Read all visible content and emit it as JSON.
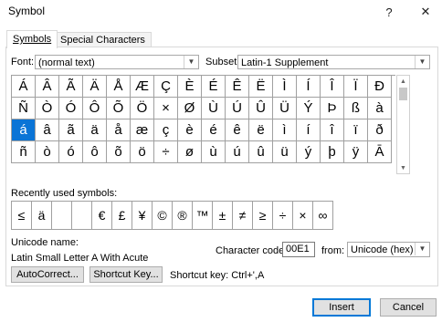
{
  "window": {
    "title": "Symbol",
    "help_glyph": "?",
    "close_glyph": "✕"
  },
  "tabs": [
    {
      "label": "Symbols"
    },
    {
      "label": "Special Characters"
    }
  ],
  "font": {
    "label": "Font:",
    "value": "(normal text)"
  },
  "subset": {
    "label": "Subset:",
    "value": "Latin-1 Supplement"
  },
  "grid": {
    "rows": [
      [
        "Á",
        "Â",
        "Ã",
        "Ä",
        "Å",
        "Æ",
        "Ç",
        "È",
        "É",
        "Ê",
        "Ë",
        "Ì",
        "Í",
        "Î",
        "Ï",
        "Ð"
      ],
      [
        "Ñ",
        "Ò",
        "Ó",
        "Ô",
        "Õ",
        "Ö",
        "×",
        "Ø",
        "Ù",
        "Ú",
        "Û",
        "Ü",
        "Ý",
        "Þ",
        "ß",
        "à"
      ],
      [
        "á",
        "â",
        "ã",
        "ä",
        "å",
        "æ",
        "ç",
        "è",
        "é",
        "ê",
        "ë",
        "ì",
        "í",
        "î",
        "ï",
        "ð"
      ],
      [
        "ñ",
        "ò",
        "ó",
        "ô",
        "õ",
        "ö",
        "÷",
        "ø",
        "ù",
        "ú",
        "û",
        "ü",
        "ý",
        "þ",
        "ÿ",
        "Ā"
      ]
    ],
    "selected": {
      "row": 2,
      "col": 0
    }
  },
  "recent": {
    "label": "Recently used symbols:",
    "symbols": [
      "≤",
      "ä",
      "",
      "",
      "€",
      "£",
      "¥",
      "©",
      "®",
      "™",
      "±",
      "≠",
      "≥",
      "÷",
      "×",
      "∞"
    ]
  },
  "unicode": {
    "label": "Unicode name:",
    "name": "Latin Small Letter A With Acute"
  },
  "code": {
    "label": "Character code:",
    "value": "00E1",
    "from_label": "from:",
    "from_value": "Unicode (hex)"
  },
  "buttons": {
    "autocorrect": "AutoCorrect...",
    "shortcut_key": "Shortcut Key...",
    "insert": "Insert",
    "cancel": "Cancel"
  },
  "shortcut": {
    "text": "Shortcut key: Ctrl+',A"
  },
  "colors": {
    "selection": "#0a74d6",
    "accent": "#0078d7"
  }
}
